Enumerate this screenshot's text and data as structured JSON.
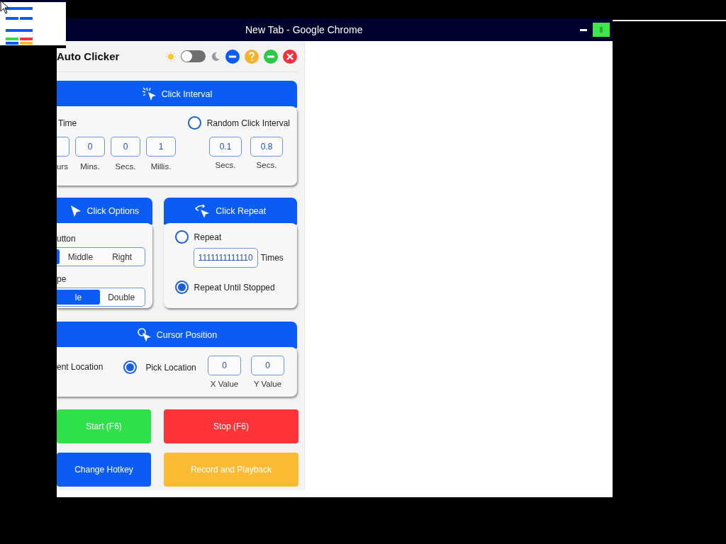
{
  "browser": {
    "title": "New Tab - Google Chrome"
  },
  "app": {
    "title": "Auto Clicker",
    "dark_mode": false
  },
  "click_interval": {
    "title": "Click Interval",
    "time_label": "Time",
    "fixed_fields": [
      {
        "label": "urs"
      },
      {
        "value": "0",
        "label": "Mins."
      },
      {
        "value": "0",
        "label": "Secs."
      },
      {
        "value": "1",
        "label": "Millis."
      }
    ],
    "random": {
      "label": "Random Click Interval",
      "selected": false,
      "fields": [
        {
          "value": "0.1",
          "label": "Secs."
        },
        {
          "value": "0.8",
          "label": "Secs."
        }
      ]
    }
  },
  "click_options": {
    "title": "Click Options",
    "groups": [
      {
        "label": "utton",
        "segments": [
          {
            "selected": true
          },
          {
            "label": "Middle",
            "selected": false
          },
          {
            "label": "Right",
            "selected": false
          }
        ]
      },
      {
        "label": "pe",
        "segments": [
          {
            "label": "le",
            "selected": true
          },
          {
            "label": "Double",
            "selected": false
          }
        ]
      }
    ]
  },
  "click_repeat": {
    "title": "Click Repeat",
    "options": [
      {
        "kind": "count",
        "label": "Repeat",
        "selected": false,
        "value": "1111111111110",
        "unit": "Times"
      },
      {
        "kind": "plain",
        "label": "Repeat Until Stopped",
        "selected": true
      }
    ]
  },
  "cursor_position": {
    "title": "Cursor Position",
    "current_label": "ent Location",
    "pick": {
      "label": "Pick Location",
      "selected": true
    },
    "fields": [
      {
        "value": "0",
        "label": "X Value"
      },
      {
        "value": "0",
        "label": "Y Value"
      }
    ]
  },
  "actions": [
    {
      "label": "Start (F6)",
      "color": "#2fe04a"
    },
    {
      "label": "Stop (F6)",
      "color": "#ff3338"
    },
    {
      "label": "Change Hotkey",
      "color": "#0a5cf5"
    },
    {
      "label": "Record and Playback",
      "color": "#fdbb34"
    }
  ]
}
